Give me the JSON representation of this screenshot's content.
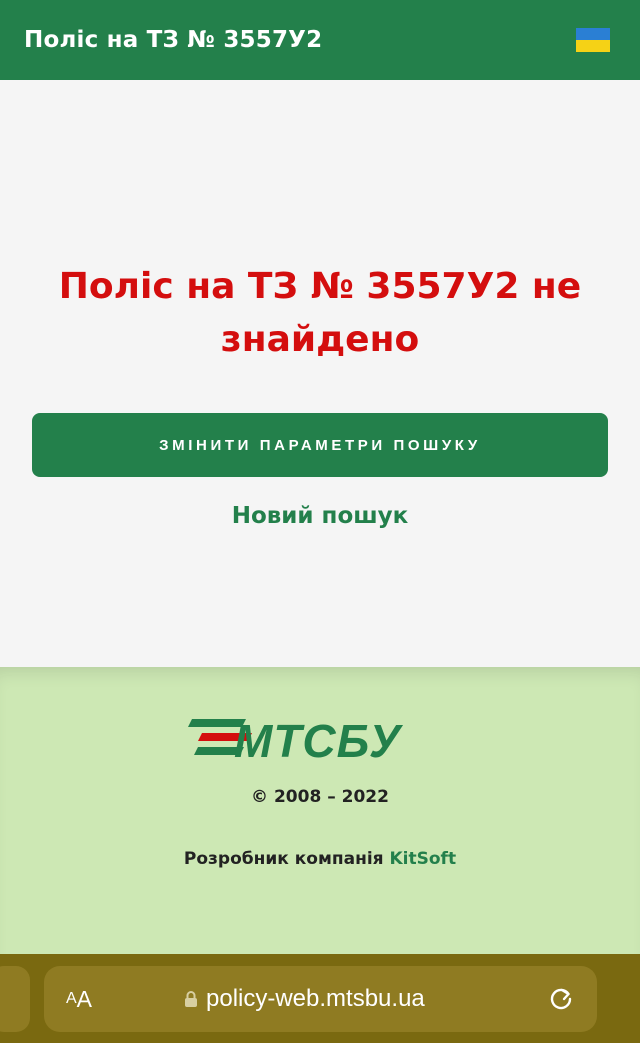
{
  "header": {
    "title": "Поліс на ТЗ № 3557У2",
    "flag_icon": "ukraine-flag-icon",
    "colors": {
      "bg": "#23804b"
    }
  },
  "main": {
    "message": "Поліс на ТЗ № 3557У2 не знайдено",
    "change_button_label": "ЗМІНИТИ ПАРАМЕТРИ ПОШУКУ",
    "new_search_link": "Новий пошук",
    "colors": {
      "error": "#d40e0e",
      "accent": "#23804b"
    }
  },
  "footer": {
    "logo_text": "МТСБУ",
    "copyright": "© 2008 – 2022",
    "developer_prefix": "Розробник компанія",
    "developer_name": "KitSoft",
    "colors": {
      "bg": "#cde8b4"
    }
  },
  "browser": {
    "aa_small": "A",
    "aa_big": "A",
    "url": "policy-web.mtsbu.ua",
    "lock_icon": "lock-icon",
    "reload_icon": "reload-icon",
    "colors": {
      "bar": "#7a6910"
    }
  }
}
